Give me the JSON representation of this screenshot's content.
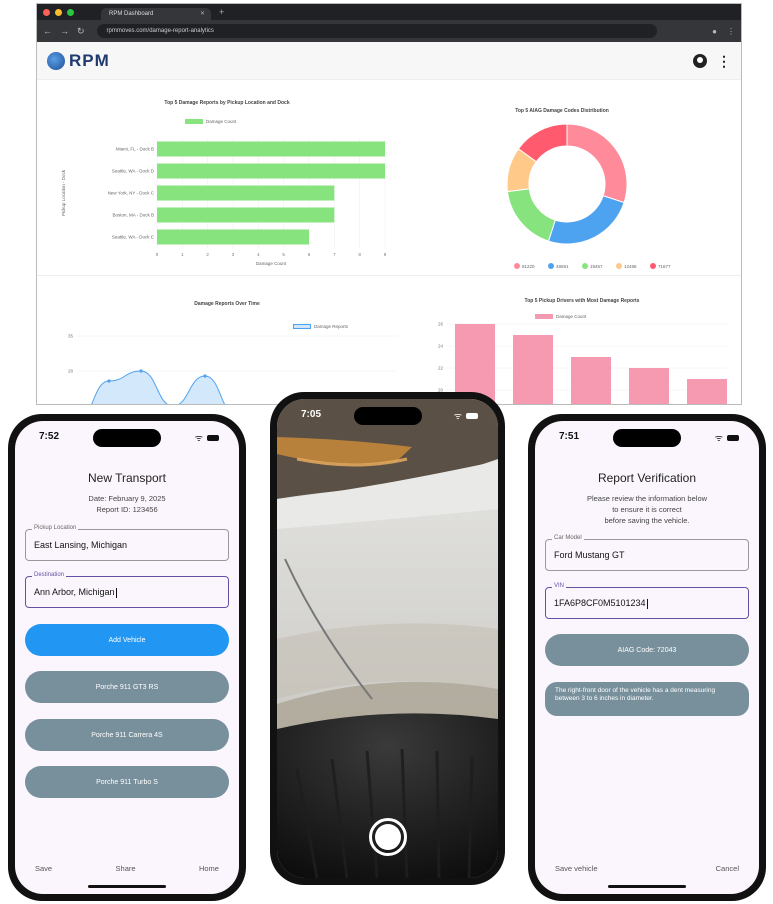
{
  "browser": {
    "tab_title": "RPM Dashboard",
    "url": "rpmmoves.com/damage-report-analytics",
    "logo_text": "RPM"
  },
  "charts": {
    "top_damage": {
      "title": "Top 5 Damage Reports by Pickup Location and Dock",
      "legend": "Damage Count",
      "ylabel": "Pickup Location - Dock",
      "xlabel": "Damage Count"
    },
    "aiag": {
      "title": "Top 5 AIAG Damage Codes Distribution",
      "legend": [
        "81220",
        "49591",
        "19457",
        "12486",
        "71677"
      ]
    },
    "over_time": {
      "title": "Damage Reports Over Time",
      "legend": "Damage Reports"
    },
    "drivers": {
      "title": "Top 5 Pickup Drivers with Most Damage Reports",
      "legend": "Damage Count"
    }
  },
  "chart_data": [
    {
      "type": "bar",
      "orientation": "horizontal",
      "title": "Top 5 Damage Reports by Pickup Location and Dock",
      "categories": [
        "Miami, FL - Dock B",
        "Seattle, WA - Dock D",
        "New York, NY - Dock C",
        "Boston, MA - Dock B",
        "Seattle, WA - Dock C"
      ],
      "values": [
        9,
        9,
        7,
        7,
        6
      ],
      "xlabel": "Damage Count",
      "ylabel": "Pickup Location - Dock",
      "xlim": [
        0,
        9
      ],
      "xticks": [
        "0",
        "1",
        "2",
        "3",
        "4",
        "5",
        "6",
        "7",
        "8",
        "9"
      ],
      "color": "#86e37e"
    },
    {
      "type": "pie",
      "title": "Top 5 AIAG Damage Codes Distribution",
      "labels": [
        "81220",
        "49591",
        "19457",
        "12486",
        "71677"
      ],
      "values": [
        30,
        25,
        18,
        12,
        15
      ],
      "colors": [
        "#ff8a9a",
        "#4ea3f0",
        "#86e37e",
        "#ffc98a",
        "#ff5a6e"
      ]
    },
    {
      "type": "area",
      "title": "Damage Reports Over Time",
      "yticks": [
        "35",
        "28",
        "21",
        "14"
      ],
      "values": [
        18,
        26,
        28,
        21,
        27,
        19,
        17,
        19,
        21,
        16,
        20
      ],
      "color": "#4ea3f0"
    },
    {
      "type": "bar",
      "title": "Top 5 Pickup Drivers with Most Damage Reports",
      "yticks": [
        "26",
        "24",
        "22",
        "20",
        "18",
        "16",
        "14",
        "12",
        "10"
      ],
      "values": [
        26,
        25,
        23,
        22,
        21
      ],
      "color": "#f59ab0"
    }
  ],
  "phone1": {
    "time": "7:52",
    "title": "New Transport",
    "date": "Date: February 9, 2025",
    "report_id": "Report ID: 123456",
    "pickup_label": "Pickup Location",
    "pickup_value": "East Lansing, Michigan",
    "dest_label": "Destination",
    "dest_value": "Ann Arbor, Michigan",
    "add_vehicle": "Add Vehicle",
    "vehicles": [
      "Porche 911 GT3 RS",
      "Porche 911 Carrera 4S",
      "Porche 911 Turbo S"
    ],
    "nav": [
      "Save",
      "Share",
      "Home"
    ]
  },
  "phone2": {
    "time": "7:05"
  },
  "phone3": {
    "time": "7:51",
    "title": "Report Verification",
    "subtitle_1": "Please review the information below",
    "subtitle_2": "to ensure it is correct",
    "subtitle_3": "before saving the vehicle.",
    "car_label": "Car Model",
    "car_value": "Ford Mustang GT",
    "vin_label": "VIN",
    "vin_value": "1FA6P8CF0M5101234",
    "aiag_code": "AIAG Code: 72043",
    "note": "The right-front door of the vehicle has a dent measuring between 3 to 6 inches in diameter.",
    "nav": [
      "Save vehicle",
      "Cancel"
    ]
  },
  "colors": {
    "primary_blue": "#2196f3",
    "pill_gray": "#78909c",
    "accent_purple": "#6750a4"
  }
}
